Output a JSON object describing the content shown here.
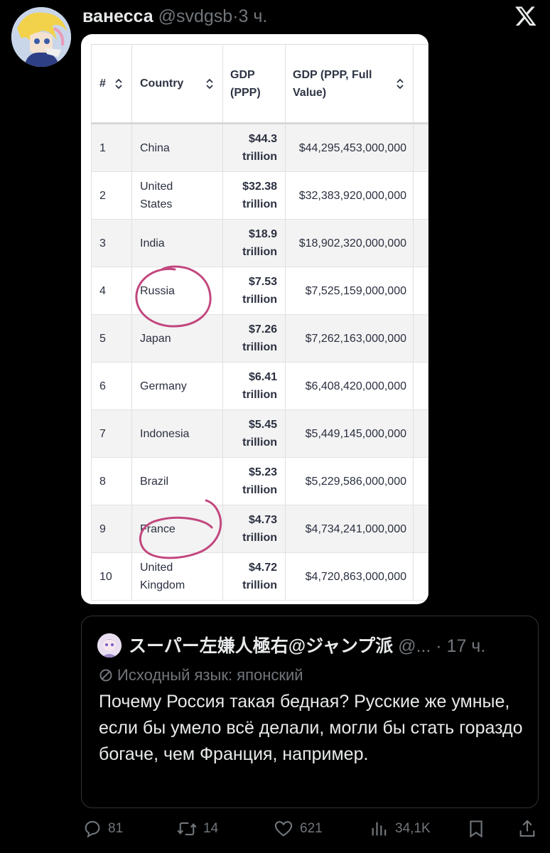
{
  "tweet": {
    "author_name": "ванесса",
    "author_handle": "@svdgsb",
    "separator": "·",
    "time": "3 ч."
  },
  "table": {
    "headers": [
      "#",
      "Country",
      "GDP (PPP)",
      "GDP (PPP, Full Value)"
    ],
    "rows": [
      {
        "rank": "1",
        "country": "China",
        "gdp": "$44.3 trillion",
        "full": "$44,295,453,000,000"
      },
      {
        "rank": "2",
        "country": "United States",
        "gdp": "$32.38 trillion",
        "full": "$32,383,920,000,000"
      },
      {
        "rank": "3",
        "country": "India",
        "gdp": "$18.9 trillion",
        "full": "$18,902,320,000,000"
      },
      {
        "rank": "4",
        "country": "Russia",
        "gdp": "$7.53 trillion",
        "full": "$7,525,159,000,000"
      },
      {
        "rank": "5",
        "country": "Japan",
        "gdp": "$7.26 trillion",
        "full": "$7,262,163,000,000"
      },
      {
        "rank": "6",
        "country": "Germany",
        "gdp": "$6.41 trillion",
        "full": "$6,408,420,000,000"
      },
      {
        "rank": "7",
        "country": "Indonesia",
        "gdp": "$5.45 trillion",
        "full": "$5,449,145,000,000"
      },
      {
        "rank": "8",
        "country": "Brazil",
        "gdp": "$5.23 trillion",
        "full": "$5,229,586,000,000"
      },
      {
        "rank": "9",
        "country": "France",
        "gdp": "$4.73 trillion",
        "full": "$4,734,241,000,000"
      },
      {
        "rank": "10",
        "country": "United Kingdom",
        "gdp": "$4.72 trillion",
        "full": "$4,720,863,000,000"
      }
    ],
    "highlight_color": "#c2477e"
  },
  "quote": {
    "author_name": "スーパー左嫌人極右@ジャンプ派",
    "author_handle": "@...",
    "separator": "·",
    "time": "17 ч.",
    "language_note": "Исходный язык: японский",
    "text": "Почему Россия такая бедная? Русские же умные, если бы умело всё делали, могли бы стать гораздо богаче, чем Франция, например."
  },
  "actions": {
    "replies": "81",
    "reposts": "14",
    "likes": "621",
    "views": "34,1K"
  },
  "colors": {
    "background": "#000000",
    "text": "#e7e9ea",
    "secondary": "#71767b",
    "border": "#2f3336"
  }
}
